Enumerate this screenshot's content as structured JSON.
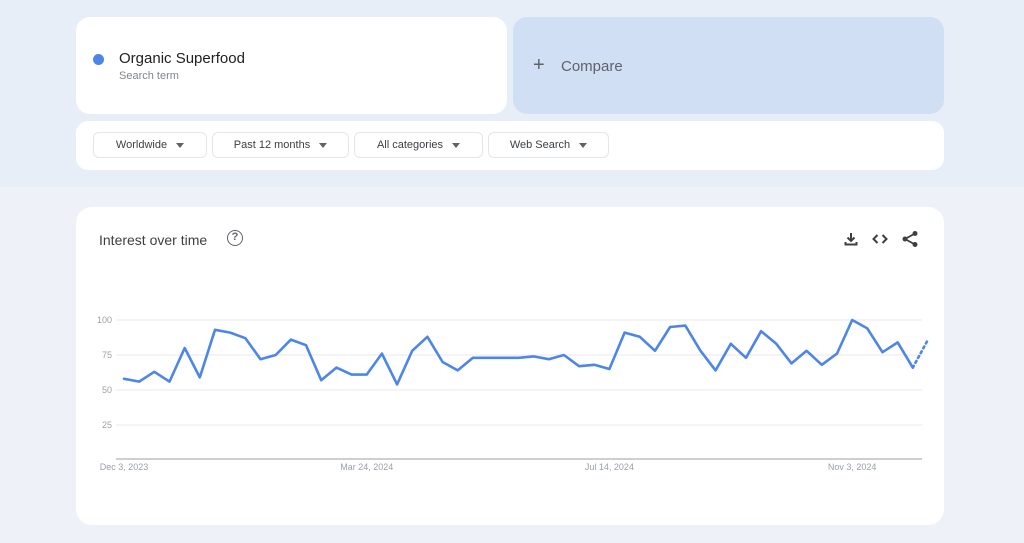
{
  "search_term": {
    "name": "Organic Superfood",
    "subtitle": "Search term",
    "color": "#4d86e8"
  },
  "compare": {
    "icon": "plus-icon",
    "label": "Compare"
  },
  "filters": [
    {
      "label": "Worldwide"
    },
    {
      "label": "Past 12 months"
    },
    {
      "label": "All categories"
    },
    {
      "label": "Web Search"
    }
  ],
  "chart_card": {
    "title": "Interest over time",
    "help_icon": "help-circle-icon",
    "actions": [
      "download-icon",
      "embed-code-icon",
      "share-icon"
    ]
  },
  "chart_data": {
    "type": "line",
    "title": "Interest over time",
    "xlabel": "",
    "ylabel": "",
    "ylim": [
      0,
      100
    ],
    "yticks": [
      25,
      50,
      75,
      100
    ],
    "grid": true,
    "x_tick_labels": [
      {
        "label": "Dec 3, 2023",
        "index": 0
      },
      {
        "label": "Mar 24, 2024",
        "index": 16
      },
      {
        "label": "Jul 14, 2024",
        "index": 32
      },
      {
        "label": "Nov 3, 2024",
        "index": 48
      }
    ],
    "x_start": "Dec 3, 2023",
    "x_interval": "weekly",
    "series": [
      {
        "name": "Organic Superfood",
        "color": "#4d86e8",
        "values": [
          58,
          56,
          63,
          56,
          80,
          59,
          93,
          91,
          87,
          72,
          75,
          86,
          82,
          57,
          66,
          61,
          61,
          76,
          54,
          78,
          88,
          70,
          64,
          73,
          73,
          73,
          73,
          74,
          72,
          75,
          67,
          68,
          65,
          91,
          88,
          78,
          95,
          96,
          78,
          64,
          83,
          73,
          92,
          83,
          69,
          78,
          68,
          76,
          100,
          94,
          77,
          84,
          66,
          86
        ],
        "partial_last_point": true
      }
    ]
  }
}
